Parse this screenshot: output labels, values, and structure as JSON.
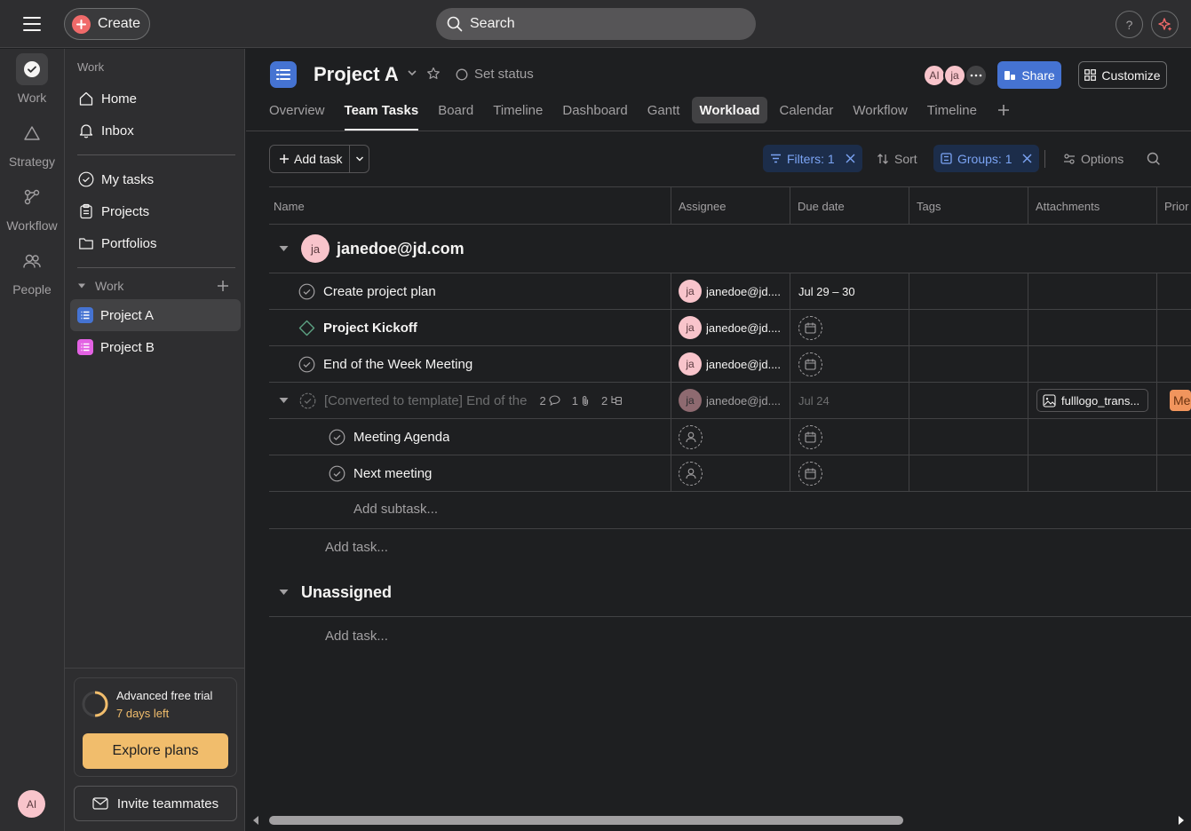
{
  "topbar": {
    "create_label": "Create",
    "search_placeholder": "Search",
    "help_label": "?"
  },
  "rail": {
    "items": [
      {
        "label": "Work",
        "icon": "check-circle-icon"
      },
      {
        "label": "Strategy",
        "icon": "triangle-icon"
      },
      {
        "label": "Workflow",
        "icon": "workflow-icon"
      },
      {
        "label": "People",
        "icon": "people-icon"
      }
    ],
    "avatar_initials": "AI"
  },
  "sidebar": {
    "heading": "Work",
    "nav": [
      {
        "label": "Home",
        "icon": "home-icon"
      },
      {
        "label": "Inbox",
        "icon": "bell-icon"
      }
    ],
    "links": [
      {
        "label": "My tasks",
        "icon": "check-circle-icon"
      },
      {
        "label": "Projects",
        "icon": "clipboard-icon"
      },
      {
        "label": "Portfolios",
        "icon": "folder-icon"
      }
    ],
    "section_label": "Work",
    "projects": [
      {
        "label": "Project A",
        "color": "#4573d2"
      },
      {
        "label": "Project B",
        "color": "#e362e3"
      }
    ],
    "trial": {
      "title": "Advanced free trial",
      "days_left": "7 days left",
      "explore_label": "Explore plans"
    },
    "invite_label": "Invite teammates"
  },
  "project": {
    "title": "Project A",
    "set_status": "Set status",
    "member_avatars": [
      "AI",
      "ja"
    ],
    "share_label": "Share",
    "customize_label": "Customize",
    "tabs": [
      "Overview",
      "Team Tasks",
      "Board",
      "Timeline",
      "Dashboard",
      "Gantt",
      "Workload",
      "Calendar",
      "Workflow",
      "Timeline"
    ],
    "active_tab": "Team Tasks",
    "highlighted_tab": "Workload"
  },
  "toolbar": {
    "add_task_label": "Add task",
    "filters_label": "Filters: 1",
    "sort_label": "Sort",
    "groups_label": "Groups: 1",
    "options_label": "Options"
  },
  "columns": [
    "Name",
    "Assignee",
    "Due date",
    "Tags",
    "Attachments",
    "Prior"
  ],
  "groups": [
    {
      "title": "janedoe@jd.com",
      "avatar": "ja",
      "tasks": [
        {
          "name": "Create project plan",
          "assignee_initials": "ja",
          "assignee": "janedoe@jd....",
          "due": "Jul 29 – 30"
        },
        {
          "name": "Project Kickoff",
          "assignee_initials": "ja",
          "assignee": "janedoe@jd....",
          "due": ""
        },
        {
          "name": "End of the Week Meeting",
          "assignee_initials": "ja",
          "assignee": "janedoe@jd....",
          "due": ""
        },
        {
          "name": "[Converted to template] End of the",
          "assignee_initials": "ja",
          "assignee": "janedoe@jd....",
          "due": "Jul 24",
          "comments": "2",
          "attachments_count": "1",
          "subtasks_count": "2",
          "attachment_name": "fulllogo_trans...",
          "priority": "Me"
        }
      ],
      "subtasks": [
        {
          "name": "Meeting Agenda"
        },
        {
          "name": "Next meeting"
        }
      ],
      "add_subtask_label": "Add subtask...",
      "add_task_label": "Add task..."
    },
    {
      "title": "Unassigned",
      "add_task_label": "Add task..."
    }
  ],
  "colors": {
    "background": "#1e1f21",
    "panel": "#2e2e30",
    "accent_blue": "#4573d2",
    "create_red": "#f06a6a",
    "trial_gold": "#f1bd6c",
    "avatar_pink": "#f8c4cb",
    "priority_orange": "#f1955d"
  }
}
